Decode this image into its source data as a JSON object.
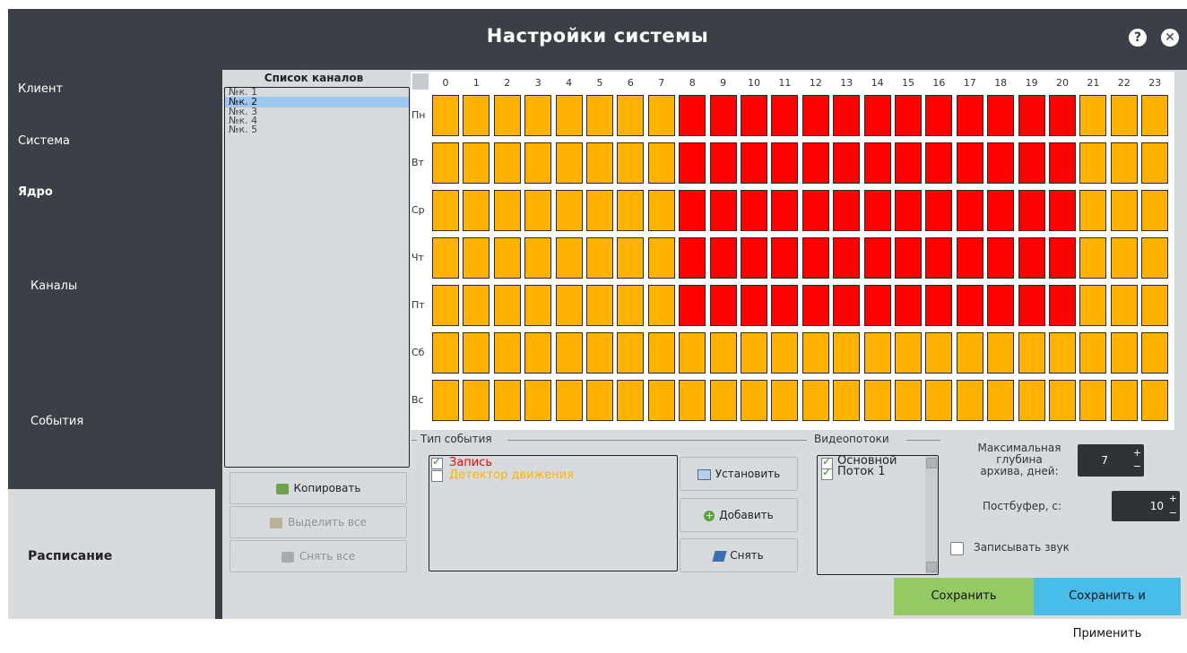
{
  "window": {
    "title": "Настройки системы",
    "help_glyph": "?",
    "close_glyph": "✕"
  },
  "nav": {
    "items": [
      {
        "label": "Клиент",
        "bold": false
      },
      {
        "label": "Система",
        "bold": false
      },
      {
        "label": "Ядро",
        "bold": true
      },
      {
        "label": "Каналы",
        "bold": false
      },
      {
        "label": "События",
        "bold": false
      }
    ],
    "active": "Расписание"
  },
  "channels": {
    "header": "Список каналов",
    "items": [
      "№к. 1",
      "№к. 2",
      "№к. 3",
      "№к. 4",
      "№к. 5"
    ],
    "selected_index": 1,
    "buttons": {
      "copy": "Копировать",
      "select_all": "Выделить все",
      "clear_all": "Снять все"
    }
  },
  "schedule": {
    "hours": [
      "0",
      "1",
      "2",
      "3",
      "4",
      "5",
      "6",
      "7",
      "8",
      "9",
      "10",
      "11",
      "12",
      "13",
      "14",
      "15",
      "16",
      "17",
      "18",
      "19",
      "20",
      "21",
      "22",
      "23"
    ],
    "days": [
      "Пн",
      "Вт",
      "Ср",
      "Чт",
      "Пт",
      "Сб",
      "Вс"
    ],
    "grid": [
      [
        "o",
        "o",
        "o",
        "o",
        "o",
        "o",
        "o",
        "o",
        "r",
        "r",
        "r",
        "r",
        "r",
        "r",
        "r",
        "r",
        "r",
        "r",
        "r",
        "r",
        "r",
        "o",
        "o",
        "o"
      ],
      [
        "o",
        "o",
        "o",
        "o",
        "o",
        "o",
        "o",
        "o",
        "r",
        "r",
        "r",
        "r",
        "r",
        "r",
        "r",
        "r",
        "r",
        "r",
        "r",
        "r",
        "r",
        "o",
        "o",
        "o"
      ],
      [
        "o",
        "o",
        "o",
        "o",
        "o",
        "o",
        "o",
        "o",
        "r",
        "r",
        "r",
        "r",
        "r",
        "r",
        "r",
        "r",
        "r",
        "r",
        "r",
        "r",
        "r",
        "o",
        "o",
        "o"
      ],
      [
        "o",
        "o",
        "o",
        "o",
        "o",
        "o",
        "o",
        "o",
        "r",
        "r",
        "r",
        "r",
        "r",
        "r",
        "r",
        "r",
        "r",
        "r",
        "r",
        "r",
        "r",
        "o",
        "o",
        "o"
      ],
      [
        "o",
        "o",
        "o",
        "o",
        "o",
        "o",
        "o",
        "o",
        "r",
        "r",
        "r",
        "r",
        "r",
        "r",
        "r",
        "r",
        "r",
        "r",
        "r",
        "r",
        "r",
        "o",
        "o",
        "o"
      ],
      [
        "o",
        "o",
        "o",
        "o",
        "o",
        "o",
        "o",
        "o",
        "o",
        "o",
        "o",
        "o",
        "o",
        "o",
        "o",
        "o",
        "o",
        "o",
        "o",
        "o",
        "o",
        "o",
        "o",
        "o"
      ],
      [
        "o",
        "o",
        "o",
        "o",
        "o",
        "o",
        "o",
        "o",
        "o",
        "o",
        "o",
        "o",
        "o",
        "o",
        "o",
        "o",
        "o",
        "o",
        "o",
        "o",
        "o",
        "o",
        "o",
        "o"
      ]
    ],
    "colors": {
      "r": "#ff0000",
      "o": "#ffb300"
    }
  },
  "event_type": {
    "label": "Тип события",
    "items": [
      {
        "label": "Запись",
        "checked": true,
        "color": "#ff0000"
      },
      {
        "label": "Детектор движения",
        "checked": false,
        "color": "#ffb300"
      }
    ]
  },
  "actions": {
    "set": "Установить",
    "add": "Добавить",
    "remove": "Снять"
  },
  "video_streams": {
    "label": "Видеопотоки",
    "items": [
      {
        "label": "Основной",
        "checked": true
      },
      {
        "label": "Поток 1",
        "checked": true
      }
    ]
  },
  "archive": {
    "label_line1": "Максимальная",
    "label_line2": "глубина",
    "label_line3": "архива, дней:",
    "value": "7"
  },
  "postbuffer": {
    "label": "Постбуфер, с:",
    "value": "10"
  },
  "record_audio": {
    "label": "Записывать звук",
    "checked": false
  },
  "footer": {
    "save": "Сохранить",
    "save_apply": "Сохранить и Применить"
  }
}
